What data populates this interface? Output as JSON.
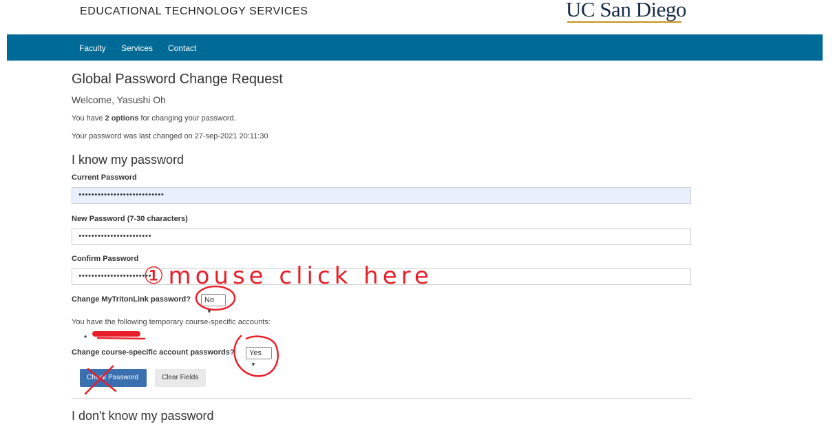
{
  "header": {
    "site_title": "EDUCATIONAL TECHNOLOGY SERVICES",
    "logo_text": "UC San Diego"
  },
  "nav": {
    "items": [
      "Faculty",
      "Services",
      "Contact"
    ]
  },
  "page": {
    "title": "Global Password Change Request",
    "welcome": "Welcome, Yasushi Oh",
    "options_prefix": "You have ",
    "options_bold": "2 options",
    "options_suffix": " for changing your password.",
    "last_changed": "Your password was last changed on 27-sep-2021 20:11:30"
  },
  "form": {
    "section_title": "I know my password",
    "current_password_label": "Current Password",
    "current_password_value": "•••••••••••••••••••••••••••",
    "new_password_label": "New Password (7-30 characters)",
    "new_password_value": "•••••••••••••••••••••••",
    "confirm_password_label": "Confirm Password",
    "confirm_password_value": "•••••••••••••••••••••••",
    "mytritonlink_label": "Change MyTritonLink password?",
    "mytritonlink_value": "No",
    "course_accounts_text": "You have the following temporary course-specific accounts:",
    "course_accounts_label": "Change course-specific account passwords?",
    "course_accounts_value": "Yes",
    "check_button": "Check Password",
    "clear_button": "Clear Fields"
  },
  "next_section": {
    "title": "I don't know my password"
  },
  "annotation": {
    "handwritten_note": "①mouse click here"
  },
  "colors": {
    "navbar": "#006a96",
    "primary_button": "#3a6fb0",
    "annotation_red": "#e8202a"
  }
}
